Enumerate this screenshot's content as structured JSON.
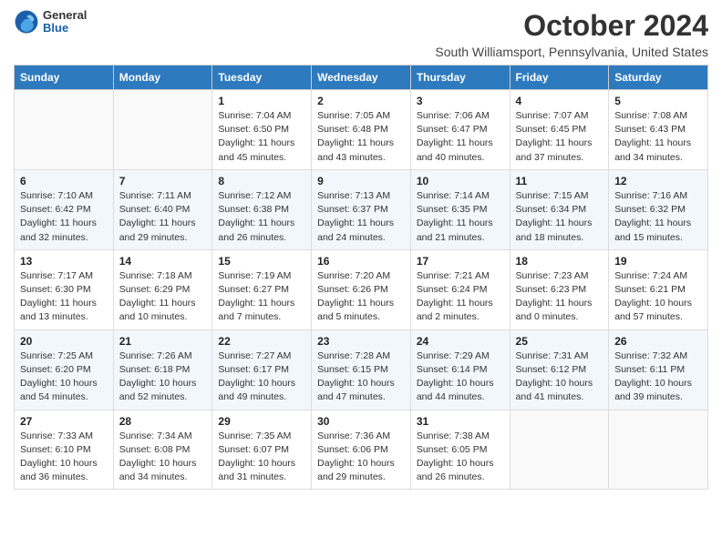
{
  "header": {
    "logo_general": "General",
    "logo_blue": "Blue",
    "month_title": "October 2024",
    "location": "South Williamsport, Pennsylvania, United States"
  },
  "days_of_week": [
    "Sunday",
    "Monday",
    "Tuesday",
    "Wednesday",
    "Thursday",
    "Friday",
    "Saturday"
  ],
  "weeks": [
    [
      {
        "day": "",
        "info": ""
      },
      {
        "day": "",
        "info": ""
      },
      {
        "day": "1",
        "info": "Sunrise: 7:04 AM\nSunset: 6:50 PM\nDaylight: 11 hours and 45 minutes."
      },
      {
        "day": "2",
        "info": "Sunrise: 7:05 AM\nSunset: 6:48 PM\nDaylight: 11 hours and 43 minutes."
      },
      {
        "day": "3",
        "info": "Sunrise: 7:06 AM\nSunset: 6:47 PM\nDaylight: 11 hours and 40 minutes."
      },
      {
        "day": "4",
        "info": "Sunrise: 7:07 AM\nSunset: 6:45 PM\nDaylight: 11 hours and 37 minutes."
      },
      {
        "day": "5",
        "info": "Sunrise: 7:08 AM\nSunset: 6:43 PM\nDaylight: 11 hours and 34 minutes."
      }
    ],
    [
      {
        "day": "6",
        "info": "Sunrise: 7:10 AM\nSunset: 6:42 PM\nDaylight: 11 hours and 32 minutes."
      },
      {
        "day": "7",
        "info": "Sunrise: 7:11 AM\nSunset: 6:40 PM\nDaylight: 11 hours and 29 minutes."
      },
      {
        "day": "8",
        "info": "Sunrise: 7:12 AM\nSunset: 6:38 PM\nDaylight: 11 hours and 26 minutes."
      },
      {
        "day": "9",
        "info": "Sunrise: 7:13 AM\nSunset: 6:37 PM\nDaylight: 11 hours and 24 minutes."
      },
      {
        "day": "10",
        "info": "Sunrise: 7:14 AM\nSunset: 6:35 PM\nDaylight: 11 hours and 21 minutes."
      },
      {
        "day": "11",
        "info": "Sunrise: 7:15 AM\nSunset: 6:34 PM\nDaylight: 11 hours and 18 minutes."
      },
      {
        "day": "12",
        "info": "Sunrise: 7:16 AM\nSunset: 6:32 PM\nDaylight: 11 hours and 15 minutes."
      }
    ],
    [
      {
        "day": "13",
        "info": "Sunrise: 7:17 AM\nSunset: 6:30 PM\nDaylight: 11 hours and 13 minutes."
      },
      {
        "day": "14",
        "info": "Sunrise: 7:18 AM\nSunset: 6:29 PM\nDaylight: 11 hours and 10 minutes."
      },
      {
        "day": "15",
        "info": "Sunrise: 7:19 AM\nSunset: 6:27 PM\nDaylight: 11 hours and 7 minutes."
      },
      {
        "day": "16",
        "info": "Sunrise: 7:20 AM\nSunset: 6:26 PM\nDaylight: 11 hours and 5 minutes."
      },
      {
        "day": "17",
        "info": "Sunrise: 7:21 AM\nSunset: 6:24 PM\nDaylight: 11 hours and 2 minutes."
      },
      {
        "day": "18",
        "info": "Sunrise: 7:23 AM\nSunset: 6:23 PM\nDaylight: 11 hours and 0 minutes."
      },
      {
        "day": "19",
        "info": "Sunrise: 7:24 AM\nSunset: 6:21 PM\nDaylight: 10 hours and 57 minutes."
      }
    ],
    [
      {
        "day": "20",
        "info": "Sunrise: 7:25 AM\nSunset: 6:20 PM\nDaylight: 10 hours and 54 minutes."
      },
      {
        "day": "21",
        "info": "Sunrise: 7:26 AM\nSunset: 6:18 PM\nDaylight: 10 hours and 52 minutes."
      },
      {
        "day": "22",
        "info": "Sunrise: 7:27 AM\nSunset: 6:17 PM\nDaylight: 10 hours and 49 minutes."
      },
      {
        "day": "23",
        "info": "Sunrise: 7:28 AM\nSunset: 6:15 PM\nDaylight: 10 hours and 47 minutes."
      },
      {
        "day": "24",
        "info": "Sunrise: 7:29 AM\nSunset: 6:14 PM\nDaylight: 10 hours and 44 minutes."
      },
      {
        "day": "25",
        "info": "Sunrise: 7:31 AM\nSunset: 6:12 PM\nDaylight: 10 hours and 41 minutes."
      },
      {
        "day": "26",
        "info": "Sunrise: 7:32 AM\nSunset: 6:11 PM\nDaylight: 10 hours and 39 minutes."
      }
    ],
    [
      {
        "day": "27",
        "info": "Sunrise: 7:33 AM\nSunset: 6:10 PM\nDaylight: 10 hours and 36 minutes."
      },
      {
        "day": "28",
        "info": "Sunrise: 7:34 AM\nSunset: 6:08 PM\nDaylight: 10 hours and 34 minutes."
      },
      {
        "day": "29",
        "info": "Sunrise: 7:35 AM\nSunset: 6:07 PM\nDaylight: 10 hours and 31 minutes."
      },
      {
        "day": "30",
        "info": "Sunrise: 7:36 AM\nSunset: 6:06 PM\nDaylight: 10 hours and 29 minutes."
      },
      {
        "day": "31",
        "info": "Sunrise: 7:38 AM\nSunset: 6:05 PM\nDaylight: 10 hours and 26 minutes."
      },
      {
        "day": "",
        "info": ""
      },
      {
        "day": "",
        "info": ""
      }
    ]
  ]
}
